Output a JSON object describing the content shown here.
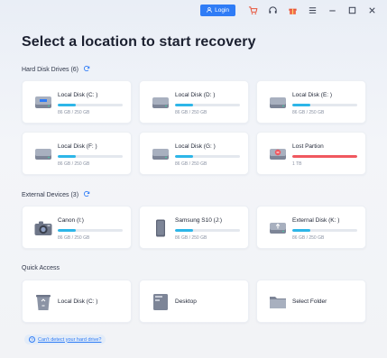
{
  "titlebar": {
    "login_label": "Login",
    "icons": [
      "cart-icon",
      "headset-icon",
      "gift-icon",
      "menu-icon",
      "minimize-icon",
      "maximize-icon",
      "close-icon"
    ]
  },
  "page_title": "Select a location to start recovery",
  "hard_disk": {
    "label": "Hard Disk Drives (6)",
    "drives": [
      {
        "name": "Local Disk (C: )",
        "size": "86 GB / 250 GB",
        "used": 0.28
      },
      {
        "name": "Local Disk (D: )",
        "size": "86 GB / 250 GB",
        "used": 0.28
      },
      {
        "name": "Local Disk (E: )",
        "size": "86 GB / 250 GB",
        "used": 0.28
      },
      {
        "name": "Local Disk (F: )",
        "size": "86 GB / 250 GB",
        "used": 0.28
      },
      {
        "name": "Local Disk (G: )",
        "size": "86 GB / 250 GB",
        "used": 0.28
      },
      {
        "name": "Lost Partion",
        "size": "1 TB",
        "used": 1.0,
        "color": "#f0585f"
      }
    ]
  },
  "external": {
    "label": "External Devices (3)",
    "drives": [
      {
        "name": "Canon (I:)",
        "size": "86 GB / 250 GB",
        "used": 0.28
      },
      {
        "name": "Samsung S10  (J:)",
        "size": "86 GB / 250 GB",
        "used": 0.28
      },
      {
        "name": "External Disk (K: )",
        "size": "86 GB / 250 GB",
        "used": 0.28
      }
    ]
  },
  "quick_access": {
    "label": "Quick Access",
    "items": [
      {
        "name": "Local Disk (C: )"
      },
      {
        "name": "Desktop"
      },
      {
        "name": "Select Folder"
      }
    ]
  },
  "help_link": "Can't detect your hard drive?",
  "colors": {
    "accent": "#2f7cf6",
    "bar": "#2db6e8",
    "lost": "#f0585f"
  }
}
